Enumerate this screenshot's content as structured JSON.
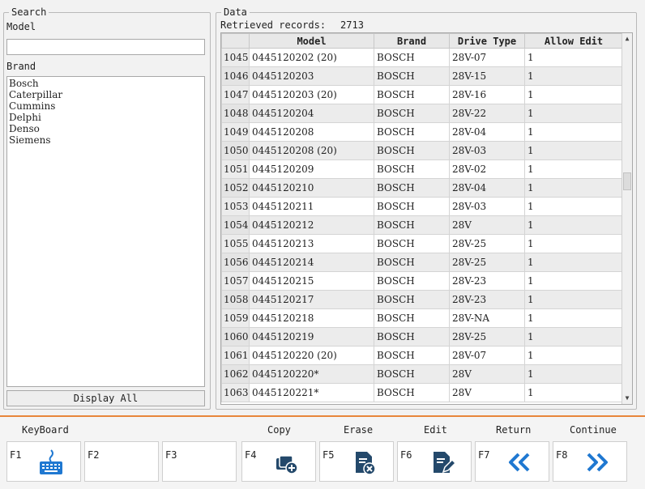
{
  "search": {
    "legend": "Search",
    "model_label": "Model",
    "model_value": "",
    "brand_label": "Brand",
    "brands": [
      "Bosch",
      "Caterpillar",
      "Cummins",
      "Delphi",
      "Denso",
      "Siemens"
    ],
    "display_all_label": "Display All"
  },
  "data": {
    "legend": "Data",
    "retrieved_label": "Retrieved records:",
    "retrieved_count": "2713",
    "columns": [
      "Model",
      "Brand",
      "Drive Type",
      "Allow Edit"
    ],
    "rows": [
      {
        "idx": "1045",
        "model": "0445120202 (20)",
        "brand": "BOSCH",
        "drive": "28V-07",
        "edit": "1"
      },
      {
        "idx": "1046",
        "model": "0445120203",
        "brand": "BOSCH",
        "drive": "28V-15",
        "edit": "1"
      },
      {
        "idx": "1047",
        "model": "0445120203 (20)",
        "brand": "BOSCH",
        "drive": "28V-16",
        "edit": "1"
      },
      {
        "idx": "1048",
        "model": "0445120204",
        "brand": "BOSCH",
        "drive": "28V-22",
        "edit": "1"
      },
      {
        "idx": "1049",
        "model": "0445120208",
        "brand": "BOSCH",
        "drive": "28V-04",
        "edit": "1"
      },
      {
        "idx": "1050",
        "model": "0445120208 (20)",
        "brand": "BOSCH",
        "drive": "28V-03",
        "edit": "1"
      },
      {
        "idx": "1051",
        "model": "0445120209",
        "brand": "BOSCH",
        "drive": "28V-02",
        "edit": "1"
      },
      {
        "idx": "1052",
        "model": "0445120210",
        "brand": "BOSCH",
        "drive": "28V-04",
        "edit": "1"
      },
      {
        "idx": "1053",
        "model": "0445120211",
        "brand": "BOSCH",
        "drive": "28V-03",
        "edit": "1"
      },
      {
        "idx": "1054",
        "model": "0445120212",
        "brand": "BOSCH",
        "drive": "28V",
        "edit": "1"
      },
      {
        "idx": "1055",
        "model": "0445120213",
        "brand": "BOSCH",
        "drive": "28V-25",
        "edit": "1"
      },
      {
        "idx": "1056",
        "model": "0445120214",
        "brand": "BOSCH",
        "drive": "28V-25",
        "edit": "1"
      },
      {
        "idx": "1057",
        "model": "0445120215",
        "brand": "BOSCH",
        "drive": "28V-23",
        "edit": "1"
      },
      {
        "idx": "1058",
        "model": "0445120217",
        "brand": "BOSCH",
        "drive": "28V-23",
        "edit": "1"
      },
      {
        "idx": "1059",
        "model": "0445120218",
        "brand": "BOSCH",
        "drive": "28V-NA",
        "edit": "1"
      },
      {
        "idx": "1060",
        "model": "0445120219",
        "brand": "BOSCH",
        "drive": "28V-25",
        "edit": "1"
      },
      {
        "idx": "1061",
        "model": "0445120220 (20)",
        "brand": "BOSCH",
        "drive": "28V-07",
        "edit": "1"
      },
      {
        "idx": "1062",
        "model": "0445120220*",
        "brand": "BOSCH",
        "drive": "28V",
        "edit": "1"
      },
      {
        "idx": "1063",
        "model": "0445120221*",
        "brand": "BOSCH",
        "drive": "28V",
        "edit": "1"
      }
    ]
  },
  "toolbar": {
    "labels": {
      "keyboard": "KeyBoard",
      "copy": "Copy",
      "erase": "Erase",
      "edit": "Edit",
      "return": "Return",
      "continue": "Continue"
    },
    "keys": [
      {
        "key": "F1",
        "icon": "keyboard-icon"
      },
      {
        "key": "F2",
        "icon": ""
      },
      {
        "key": "F3",
        "icon": ""
      },
      {
        "key": "F4",
        "icon": "copy-add-icon"
      },
      {
        "key": "F5",
        "icon": "erase-file-icon"
      },
      {
        "key": "F6",
        "icon": "edit-file-icon"
      },
      {
        "key": "F7",
        "icon": "double-chevron-left-icon"
      },
      {
        "key": "F8",
        "icon": "double-chevron-right-icon"
      }
    ]
  },
  "colors": {
    "accent": "#e8863a",
    "icon_blue": "#1f78d1",
    "icon_dark": "#24496b"
  }
}
